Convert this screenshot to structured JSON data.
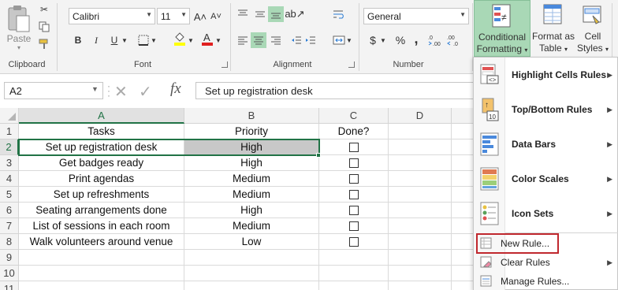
{
  "ribbon": {
    "clipboard": {
      "paste_label": "Paste",
      "group_label": "Clipboard"
    },
    "font": {
      "font_name": "Calibri",
      "font_size": "11",
      "bold": "B",
      "italic": "I",
      "underline": "U",
      "grow": "A˄",
      "shrink": "A˅",
      "group_label": "Font"
    },
    "alignment": {
      "group_label": "Alignment"
    },
    "number": {
      "format": "General",
      "currency": "$",
      "percent": "%",
      "comma": ",",
      "group_label": "Number"
    },
    "styles": {
      "conditional_line1": "Conditional",
      "conditional_line2": "Formatting",
      "format_table_line1": "Format as",
      "format_table_line2": "Table",
      "cell_styles_line1": "Cell",
      "cell_styles_line2": "Styles"
    }
  },
  "formula_bar": {
    "name_box": "A2",
    "fx": "fx",
    "content": "Set up registration desk"
  },
  "columns": [
    "A",
    "B",
    "C",
    "D"
  ],
  "rows": [
    {
      "n": "1",
      "a": "Tasks",
      "b": "Priority",
      "c": "Done?",
      "box": false
    },
    {
      "n": "2",
      "a": "Set up registration desk",
      "b": "High",
      "c": "",
      "box": true
    },
    {
      "n": "3",
      "a": "Get badges ready",
      "b": "High",
      "c": "",
      "box": true
    },
    {
      "n": "4",
      "a": "Print agendas",
      "b": "Medium",
      "c": "",
      "box": true
    },
    {
      "n": "5",
      "a": "Set up refreshments",
      "b": "Medium",
      "c": "",
      "box": true
    },
    {
      "n": "6",
      "a": "Seating arrangements done",
      "b": "High",
      "c": "",
      "box": true
    },
    {
      "n": "7",
      "a": "List of sessions in each room",
      "b": "Medium",
      "c": "",
      "box": true
    },
    {
      "n": "8",
      "a": "Walk volunteers around venue",
      "b": "Low",
      "c": "",
      "box": true
    },
    {
      "n": "9",
      "a": "",
      "b": "",
      "c": "",
      "box": false
    },
    {
      "n": "10",
      "a": "",
      "b": "",
      "c": "",
      "box": false
    },
    {
      "n": "11",
      "a": "",
      "b": "",
      "c": "",
      "box": false
    }
  ],
  "menu": {
    "items": [
      {
        "label": "Highlight Cells Rules",
        "icon": "highlight-cells-icon",
        "submenu": true
      },
      {
        "label": "Top/Bottom Rules",
        "icon": "top-bottom-icon",
        "submenu": true
      },
      {
        "label": "Data Bars",
        "icon": "data-bars-icon",
        "submenu": true
      },
      {
        "label": "Color Scales",
        "icon": "color-scales-icon",
        "submenu": true
      },
      {
        "label": "Icon Sets",
        "icon": "icon-sets-icon",
        "submenu": true
      }
    ],
    "small_items": [
      {
        "label": "New Rule...",
        "icon": "new-rule-icon",
        "submenu": false
      },
      {
        "label": "Clear Rules",
        "icon": "clear-rules-icon",
        "submenu": true
      },
      {
        "label": "Manage Rules...",
        "icon": "manage-rules-icon",
        "submenu": false
      }
    ]
  },
  "colors": {
    "accent": "#217346",
    "highlight": "#a9d8b6",
    "selected_cell": "#c8c8c8",
    "callout": "#c0282e"
  }
}
